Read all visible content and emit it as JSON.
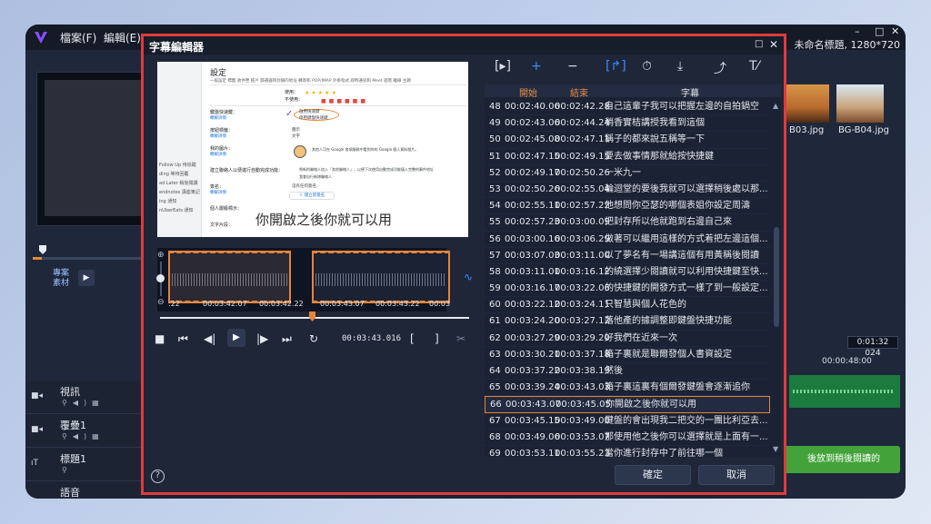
{
  "app": {
    "menu": {
      "file": "檔案(F)",
      "edit": "編輯(E)"
    },
    "window_title": "未命名標題, 1280*720",
    "window_controls": {
      "minimize": "–",
      "maximize": "□",
      "close": "✕"
    }
  },
  "left_panel": {
    "project_label": "專案",
    "clip_label": "素材",
    "tracks": [
      {
        "name": "視訊",
        "icon": "video-track-icon"
      },
      {
        "name": "覆疊1",
        "icon": "overlay-track-icon"
      },
      {
        "name": "標題1",
        "icon": "title-track-icon"
      },
      {
        "name": "語音",
        "icon": "voice-track-icon"
      }
    ]
  },
  "right_panel": {
    "thumbs": [
      "B03.jpg",
      "BG-B04.jpg"
    ],
    "timecode": "0:01:32 024",
    "ruler_label": "00:00:48:00",
    "subtitle_track_text": "後放到稍後閱讀的"
  },
  "dialog": {
    "title": "字幕編輯器",
    "preview": {
      "settings_heading": "設定",
      "tabs": "一般設定   標籤   收件匣   帳戶   篩選器和封鎖的地址   轉寄和 POP/IMAP   外掛程式   即時通訊和 Meet   進階   離線   主題",
      "sidebar_items": [
        "Follow Up 待追蹤",
        "ding 等待回覆",
        "ad Later 稍後閱讀",
        "endnotes 講座筆記",
        "ing 通知",
        "nUberEats 通知"
      ],
      "rows": [
        "使用：",
        "不使用：",
        "鍵盤快速鍵：",
        "按鈕標籤：",
        "我的圖片：",
        "建立聯絡人以便進行自動完成功能：",
        "簽名：",
        "個人層級標示：",
        "文字片段："
      ],
      "links": [
        "瞭解詳情",
        "瞭解詳情",
        "瞭解詳情",
        "瞭解詳情"
      ],
      "kb_on": "啟用快速鍵",
      "kb_off": "停用鍵盤快速鍵",
      "btn_icon": "圖示",
      "btn_text": "文字",
      "picture_desc": "其他人可在 Google 各項服務中看到你的 Google 個人資料相片。",
      "contacts_desc1": "將新的聯絡人加入「其他聯絡人」，以便下次使用自動完成功能填入完整的郵件地址",
      "contacts_desc2": "我會自行新增聯絡人",
      "no_sig": "沒有任何簽名",
      "new_sig": "＋ 建立新簽名",
      "caption": "你開啟之後你就可以用"
    },
    "wave_times": [
      ":22",
      "00:03:42.07",
      "00:03:42.22",
      "00:03:43.07",
      "00:03:43.22",
      "00:03"
    ],
    "transport": {
      "timecode": "00:03:43.016",
      "icons": [
        "stop-icon",
        "to-start-icon",
        "prev-frame-icon",
        "play-icon",
        "next-frame-icon",
        "to-end-icon",
        "repeat-icon"
      ]
    },
    "toolbar_icons": [
      "insert-subtitle-icon",
      "add-icon",
      "remove-icon",
      "split-icon",
      "time-offset-icon",
      "import-icon",
      "export-icon",
      "text-options-icon"
    ],
    "table": {
      "headers": {
        "start": "開始",
        "end": "結束",
        "subtitle": "字幕"
      },
      "rows": [
        {
          "no": "48",
          "start": "00:02:40.06",
          "end": "00:02:42.28",
          "text": "自己這輩子我可以把握左邊的自拍鍋空"
        },
        {
          "no": "49",
          "start": "00:02:43.06",
          "end": "00:02:44.24",
          "text": "稍香實桔講授我看到這個"
        },
        {
          "no": "50",
          "start": "00:02:45.08",
          "end": "00:02:47.11",
          "text": "稱子的都來說五稱等一下"
        },
        {
          "no": "51",
          "start": "00:02:47.15",
          "end": "00:02:49.15",
          "text": "要去做事情那就給按快捷鍵"
        },
        {
          "no": "52",
          "start": "00:02:49.17",
          "end": "00:02:50.26",
          "text": "一米九一"
        },
        {
          "no": "53",
          "start": "00:02:50.26",
          "end": "00:02:55.04",
          "text": "輪迴堂的要後我就可以選擇稍後處以那..."
        },
        {
          "no": "54",
          "start": "00:02:55.11",
          "end": "00:02:57.22",
          "text": "他想問你亞瑟的哪個表姐你設定周濤"
        },
        {
          "no": "55",
          "start": "00:02:57.23",
          "end": "00:03:00.09",
          "text": "把封存所以他就跑到右邊自己來"
        },
        {
          "no": "56",
          "start": "00:03:00.16",
          "end": "00:03:06.29",
          "text": "做著可以繼用這樣的方式着把左邊這個..."
        },
        {
          "no": "57",
          "start": "00:03:07.03",
          "end": "00:03:11.00",
          "text": "以了夢名有一場講這個有用黃稱後閱讀"
        },
        {
          "no": "58",
          "start": "00:03:11.01",
          "end": "00:03:16.12",
          "text": "的繞選擇少閱讀就可以利用快捷鍵至快..."
        },
        {
          "no": "59",
          "start": "00:03:16.17",
          "end": "00:03:22.06",
          "text": "的快捷鍵的開發方式一樣了到一般設定..."
        },
        {
          "no": "60",
          "start": "00:03:22.12",
          "end": "00:03:24.11",
          "text": "只智慧與個人花色的"
        },
        {
          "no": "61",
          "start": "00:03:24.20",
          "end": "00:03:27.12",
          "text": "落他產的據調整即鍵盤快捷功能"
        },
        {
          "no": "62",
          "start": "00:03:27.29",
          "end": "00:03:29.20",
          "text": "好我們在近來一次"
        },
        {
          "no": "63",
          "start": "00:03:30.21",
          "end": "00:03:37.18",
          "text": "箱子裏就是聯爾發個人書資設定"
        },
        {
          "no": "64",
          "start": "00:03:37.22",
          "end": "00:03:38.19",
          "text": "然後"
        },
        {
          "no": "65",
          "start": "00:03:39.24",
          "end": "00:03:43.03",
          "text": "箱子裏這裏有個爾發鍵盤會逐漸追你"
        },
        {
          "no": "66",
          "start": "00:03:43.07",
          "end": "00:03:45.05",
          "text": "你開啟之後你就可以用"
        },
        {
          "no": "67",
          "start": "00:03:45.15",
          "end": "00:03:49.00",
          "text": "鍵盤的會出現我二把交的一團比利亞去..."
        },
        {
          "no": "68",
          "start": "00:03:49.06",
          "end": "00:03:53.07",
          "text": "那使用他之後你可以選擇就是上面有一..."
        },
        {
          "no": "69",
          "start": "00:03:53.11",
          "end": "00:03:55.23",
          "text": "當你進行封存中了前往哪一個"
        }
      ]
    },
    "ok_label": "確定",
    "cancel_label": "取消",
    "colors": {
      "border": "#e03b3b",
      "accent": "#e4853c",
      "header_text": "#e58c4a"
    }
  }
}
